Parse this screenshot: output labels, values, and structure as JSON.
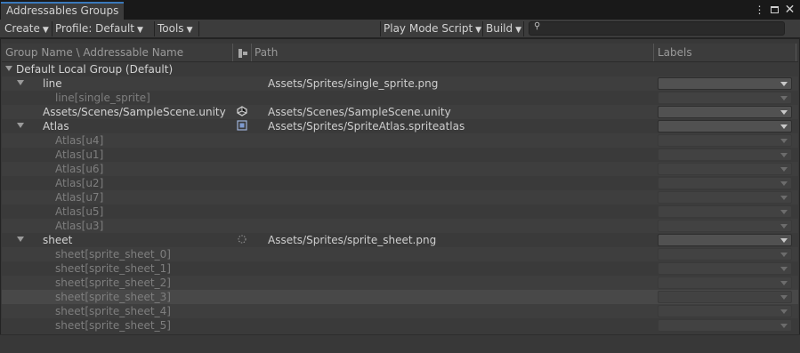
{
  "window": {
    "tab_title": "Addressables Groups",
    "menu_icon": "kebab-menu-icon",
    "maximize_icon": "maximize-icon",
    "close_icon": "close-icon"
  },
  "toolbar": {
    "create": "Create",
    "profile": "Profile: Default",
    "tools": "Tools",
    "play_mode_script": "Play Mode Script",
    "build": "Build",
    "search_placeholder": ""
  },
  "columns": {
    "name": "Group Name \\ Addressable Name",
    "path": "Path",
    "labels": "Labels"
  },
  "group": {
    "name": "Default Local Group (Default)"
  },
  "entries": [
    {
      "name": "line",
      "path": "Assets/Sprites/single_sprite.png",
      "icon": "sprite-icon"
    },
    {
      "name": "line[single_sprite]",
      "path": "",
      "icon": ""
    },
    {
      "name": "Assets/Scenes/SampleScene.unity",
      "path": "Assets/Scenes/SampleScene.unity",
      "icon": "unity-scene-icon"
    },
    {
      "name": "Atlas",
      "path": "Assets/Sprites/SpriteAtlas.spriteatlas",
      "icon": "sprite-atlas-icon"
    },
    {
      "name": "Atlas[u4]",
      "path": "",
      "icon": ""
    },
    {
      "name": "Atlas[u1]",
      "path": "",
      "icon": ""
    },
    {
      "name": "Atlas[u6]",
      "path": "",
      "icon": ""
    },
    {
      "name": "Atlas[u2]",
      "path": "",
      "icon": ""
    },
    {
      "name": "Atlas[u7]",
      "path": "",
      "icon": ""
    },
    {
      "name": "Atlas[u5]",
      "path": "",
      "icon": ""
    },
    {
      "name": "Atlas[u3]",
      "path": "",
      "icon": ""
    },
    {
      "name": "sheet",
      "path": "Assets/Sprites/sprite_sheet.png",
      "icon": "sprite-icon"
    },
    {
      "name": "sheet[sprite_sheet_0]",
      "path": "",
      "icon": ""
    },
    {
      "name": "sheet[sprite_sheet_1]",
      "path": "",
      "icon": ""
    },
    {
      "name": "sheet[sprite_sheet_2]",
      "path": "",
      "icon": ""
    },
    {
      "name": "sheet[sprite_sheet_3]",
      "path": "",
      "icon": ""
    },
    {
      "name": "sheet[sprite_sheet_4]",
      "path": "",
      "icon": ""
    },
    {
      "name": "sheet[sprite_sheet_5]",
      "path": "",
      "icon": ""
    }
  ]
}
